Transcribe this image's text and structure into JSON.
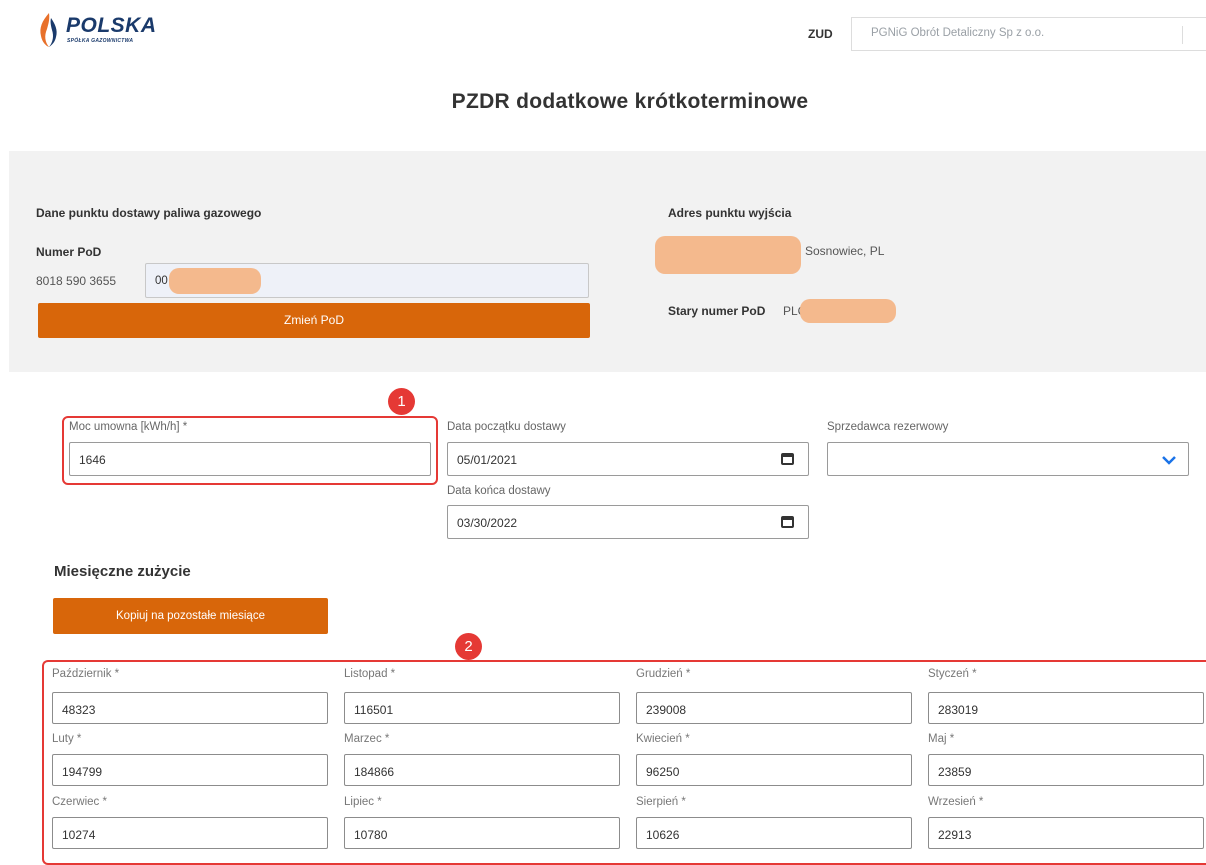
{
  "header": {
    "logo_title": "POLSKA",
    "logo_subtitle": "SPÓŁKA GAZOWNICTWA",
    "zud_label": "ZUD",
    "zud_value": "PGNiG Obrót Detaliczny Sp z o.o."
  },
  "page_title": "PZDR dodatkowe krótkoterminowe",
  "pod_section": {
    "title": "Dane punktu dostawy paliwa gazowego",
    "pod_label": "Numer PoD",
    "pod_prefix": "8018 590 3655",
    "pod_input_value": "00",
    "change_button": "Zmień PoD",
    "address_title": "Adres punktu wyjścia",
    "address_city": "Sosnowiec, PL",
    "old_pod_label": "Stary numer PoD",
    "old_pod_prefix": "PLC"
  },
  "form": {
    "moc_label": "Moc umowna [kWh/h] *",
    "moc_value": "1646",
    "start_label": "Data początku dostawy",
    "start_value": "05/01/2021",
    "end_label": "Data końca dostawy",
    "end_value": "03/30/2022",
    "seller_label": "Sprzedawca rezerwowy",
    "seller_value": ""
  },
  "annotations": {
    "badge1": "1",
    "badge2": "2"
  },
  "monthly": {
    "title": "Miesięczne zużycie",
    "copy_button": "Kopiuj na pozostałe miesiące",
    "months": [
      {
        "label": "Październik *",
        "value": "48323"
      },
      {
        "label": "Listopad *",
        "value": "116501"
      },
      {
        "label": "Grudzień *",
        "value": "239008"
      },
      {
        "label": "Styczeń *",
        "value": "283019"
      },
      {
        "label": "Luty *",
        "value": "194799"
      },
      {
        "label": "Marzec *",
        "value": "184866"
      },
      {
        "label": "Kwiecień *",
        "value": "96250"
      },
      {
        "label": "Maj *",
        "value": "23859"
      },
      {
        "label": "Czerwiec *",
        "value": "10274"
      },
      {
        "label": "Lipiec *",
        "value": "10780"
      },
      {
        "label": "Sierpień *",
        "value": "10626"
      },
      {
        "label": "Wrzesień *",
        "value": "22913"
      }
    ]
  },
  "colors": {
    "accent": "#d8660a",
    "highlight": "#e53935",
    "panel": "#f2f2f2",
    "logo": "#1a3a6b"
  },
  "icons": [
    "flame-logo-icon",
    "calendar-icon",
    "chevron-down-icon"
  ]
}
